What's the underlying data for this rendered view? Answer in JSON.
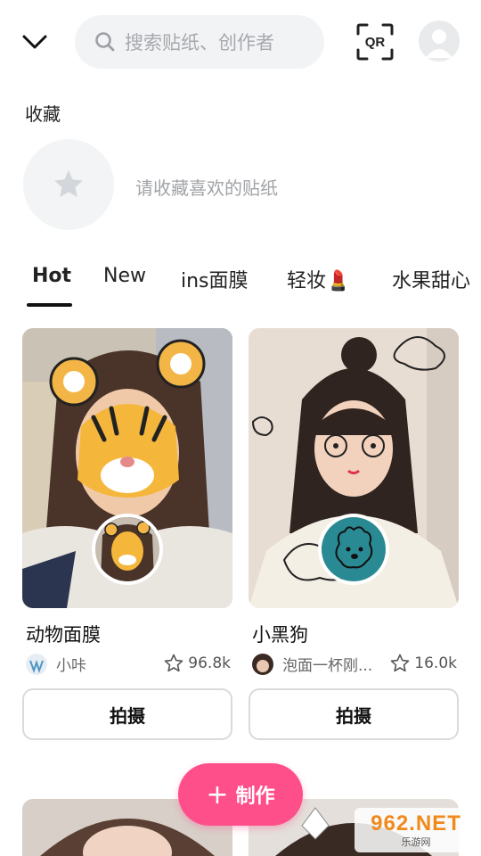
{
  "search": {
    "placeholder": "搜索贴纸、创作者"
  },
  "qr": {
    "label": "QR"
  },
  "favorites": {
    "title": "收藏",
    "hint": "请收藏喜欢的贴纸"
  },
  "tabs": [
    {
      "label": "Hot"
    },
    {
      "label": "New"
    },
    {
      "label": "ins面膜"
    },
    {
      "label": "轻妆💄"
    },
    {
      "label": "水果甜心"
    }
  ],
  "cards": [
    {
      "name": "动物面膜",
      "author": "小咔",
      "likes": "96.8k",
      "button": "拍摄"
    },
    {
      "name": "小黑狗",
      "author": "泡面一杯刚...",
      "likes": "16.0k",
      "button": "拍摄"
    }
  ],
  "create_button": {
    "label": "制作",
    "color": "#ff4f8b"
  },
  "watermark": {
    "line1": "962.NET",
    "line2": "乐游网"
  }
}
